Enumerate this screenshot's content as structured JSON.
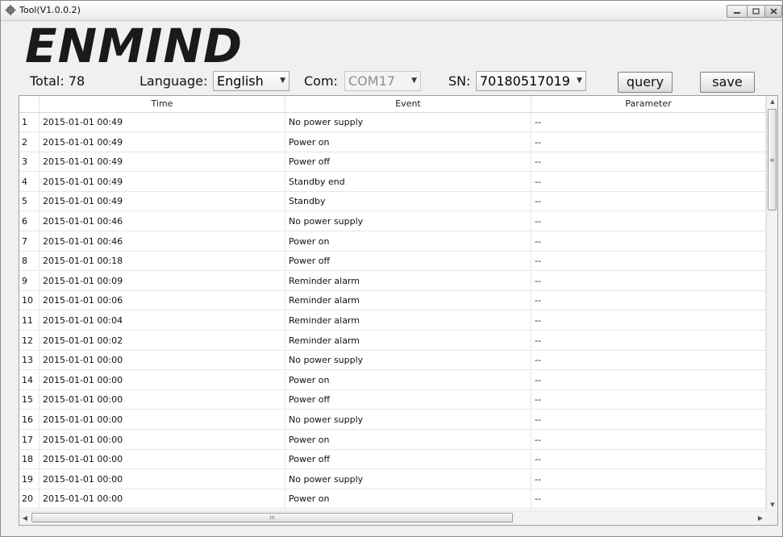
{
  "window": {
    "title": "Tool(V1.0.0.2)",
    "icons": {
      "app": "gear-icon",
      "minimize": "minimize-icon",
      "maximize": "maximize-icon",
      "close": "close-icon"
    }
  },
  "logo": {
    "text": "ENMIND"
  },
  "toolbar": {
    "total_label": "Total: 78",
    "language_label": "Language:",
    "language_value": "English",
    "com_label": "Com:",
    "com_value": "COM17",
    "sn_label": "SN:",
    "sn_value": "70180517019",
    "query_label": "query",
    "save_label": "save"
  },
  "table": {
    "columns": [
      "Time",
      "Event",
      "Parameter"
    ],
    "rows": [
      {
        "n": "1",
        "time": "2015-01-01 00:49",
        "event": "No power supply",
        "param": "--"
      },
      {
        "n": "2",
        "time": "2015-01-01 00:49",
        "event": "Power on",
        "param": "--"
      },
      {
        "n": "3",
        "time": "2015-01-01 00:49",
        "event": "Power off",
        "param": "--"
      },
      {
        "n": "4",
        "time": "2015-01-01 00:49",
        "event": "Standby end",
        "param": "--"
      },
      {
        "n": "5",
        "time": "2015-01-01 00:49",
        "event": "Standby",
        "param": "--"
      },
      {
        "n": "6",
        "time": "2015-01-01 00:46",
        "event": "No power supply",
        "param": "--"
      },
      {
        "n": "7",
        "time": "2015-01-01 00:46",
        "event": "Power on",
        "param": "--"
      },
      {
        "n": "8",
        "time": "2015-01-01 00:18",
        "event": "Power off",
        "param": "--"
      },
      {
        "n": "9",
        "time": "2015-01-01 00:09",
        "event": "Reminder alarm",
        "param": "--"
      },
      {
        "n": "10",
        "time": "2015-01-01 00:06",
        "event": "Reminder alarm",
        "param": "--"
      },
      {
        "n": "11",
        "time": "2015-01-01 00:04",
        "event": "Reminder alarm",
        "param": "--"
      },
      {
        "n": "12",
        "time": "2015-01-01 00:02",
        "event": "Reminder alarm",
        "param": "--"
      },
      {
        "n": "13",
        "time": "2015-01-01 00:00",
        "event": "No power supply",
        "param": "--"
      },
      {
        "n": "14",
        "time": "2015-01-01 00:00",
        "event": "Power on",
        "param": "--"
      },
      {
        "n": "15",
        "time": "2015-01-01 00:00",
        "event": "Power off",
        "param": "--"
      },
      {
        "n": "16",
        "time": "2015-01-01 00:00",
        "event": "No power supply",
        "param": "--"
      },
      {
        "n": "17",
        "time": "2015-01-01 00:00",
        "event": "Power on",
        "param": "--"
      },
      {
        "n": "18",
        "time": "2015-01-01 00:00",
        "event": "Power off",
        "param": "--"
      },
      {
        "n": "19",
        "time": "2015-01-01 00:00",
        "event": "No power supply",
        "param": "--"
      },
      {
        "n": "20",
        "time": "2015-01-01 00:00",
        "event": "Power on",
        "param": "--"
      }
    ]
  },
  "scrollbars": {
    "vertical_grip": "≡",
    "horizontal_grip": "ııı"
  },
  "colors": {
    "window_bg": "#f0f0f0",
    "grid_border": "#a0a0a0",
    "disabled_text": "#8e8e8e"
  }
}
